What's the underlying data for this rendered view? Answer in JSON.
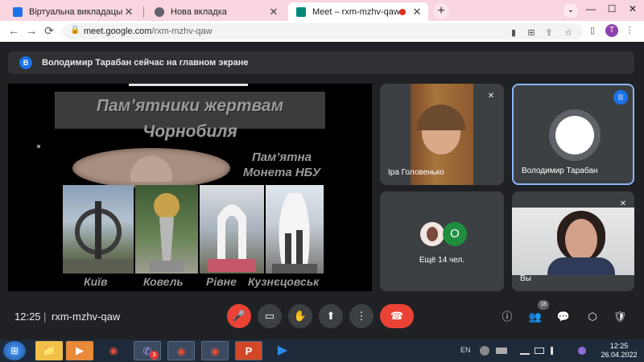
{
  "browser": {
    "tabs": [
      {
        "title": "Віртуальна викладацька ВСП \"Б",
        "favicon_color": "#1a73e8",
        "close": "✕"
      },
      {
        "title": "Нова вкладка",
        "favicon_color": "#5f6368",
        "close": "✕"
      },
      {
        "title": "Meet – rxm-mzhv-qaw",
        "favicon_color": "#00897b",
        "close": "✕",
        "recording": true
      }
    ],
    "new_tab": "+",
    "window_controls": {
      "expand": "⌄",
      "minimize": "—",
      "maximize": "☐",
      "close": "✕"
    },
    "nav": {
      "back": "←",
      "forward": "→",
      "reload": "⟳"
    },
    "url_host": "meet.google.com",
    "url_path": "/rxm-mzhv-qaw",
    "lock_icon": "🔒",
    "toolbar_icons": {
      "camera": "▮",
      "translate": "⊞",
      "share": "⇪",
      "bookmark": "☆",
      "sidepanel": "▯",
      "menu": "⋮"
    },
    "profile_letter": "T"
  },
  "notice": {
    "avatar_letter": "В",
    "text": "Володимир Тарабан сейчас на главном экране"
  },
  "slide": {
    "title_line1": "Пам’ятники жертвам",
    "title_line2": "Чорнобиля",
    "coin_label": "Пам’ятна Монета НБУ",
    "cities": [
      "Київ",
      "Ковель",
      "Рівне",
      "Кузнєцовськ"
    ]
  },
  "participants": [
    {
      "name": "Іра Головенько",
      "muted": true
    },
    {
      "name": "Володимир Тарабан",
      "speaking": true
    },
    {
      "name": "Ещё 14 чел.",
      "avatar_letter": "О",
      "avatar_color": "#1e8e3e"
    },
    {
      "name": "Вы",
      "muted": true
    }
  ],
  "meeting": {
    "time": "12:25",
    "separator": "|",
    "code": "rxm-mzhv-qaw",
    "controls": {
      "mic": "🎤",
      "camera": "▭",
      "hand": "✋",
      "present": "⬆",
      "more": "⋮",
      "end": "☎"
    },
    "right_icons": {
      "info": "ⓘ",
      "people": "👥",
      "chat": "💬",
      "activities": "⬡",
      "host": "🛡"
    },
    "people_count": "18"
  },
  "taskbar": {
    "start": "⊞",
    "apps": [
      {
        "name": "explorer",
        "glyph": "📁",
        "color": "#f0c048"
      },
      {
        "name": "media",
        "glyph": "▶",
        "color": "#e88a3a"
      },
      {
        "name": "chrome",
        "glyph": "◉",
        "color": "#e44d3a"
      },
      {
        "name": "viber",
        "glyph": "✆",
        "color": "#7a5ae0",
        "badge": "3"
      },
      {
        "name": "chrome-2",
        "glyph": "◉",
        "color": "#e44d3a"
      },
      {
        "name": "chrome-3",
        "glyph": "◉",
        "color": "#e44d3a"
      },
      {
        "name": "powerpoint",
        "glyph": "P",
        "color": "#d24726"
      },
      {
        "name": "player",
        "glyph": "▶",
        "color": "#2a8ce8"
      }
    ],
    "lang": "EN",
    "clock_time": "12:25",
    "clock_date": "26.04.2022"
  }
}
